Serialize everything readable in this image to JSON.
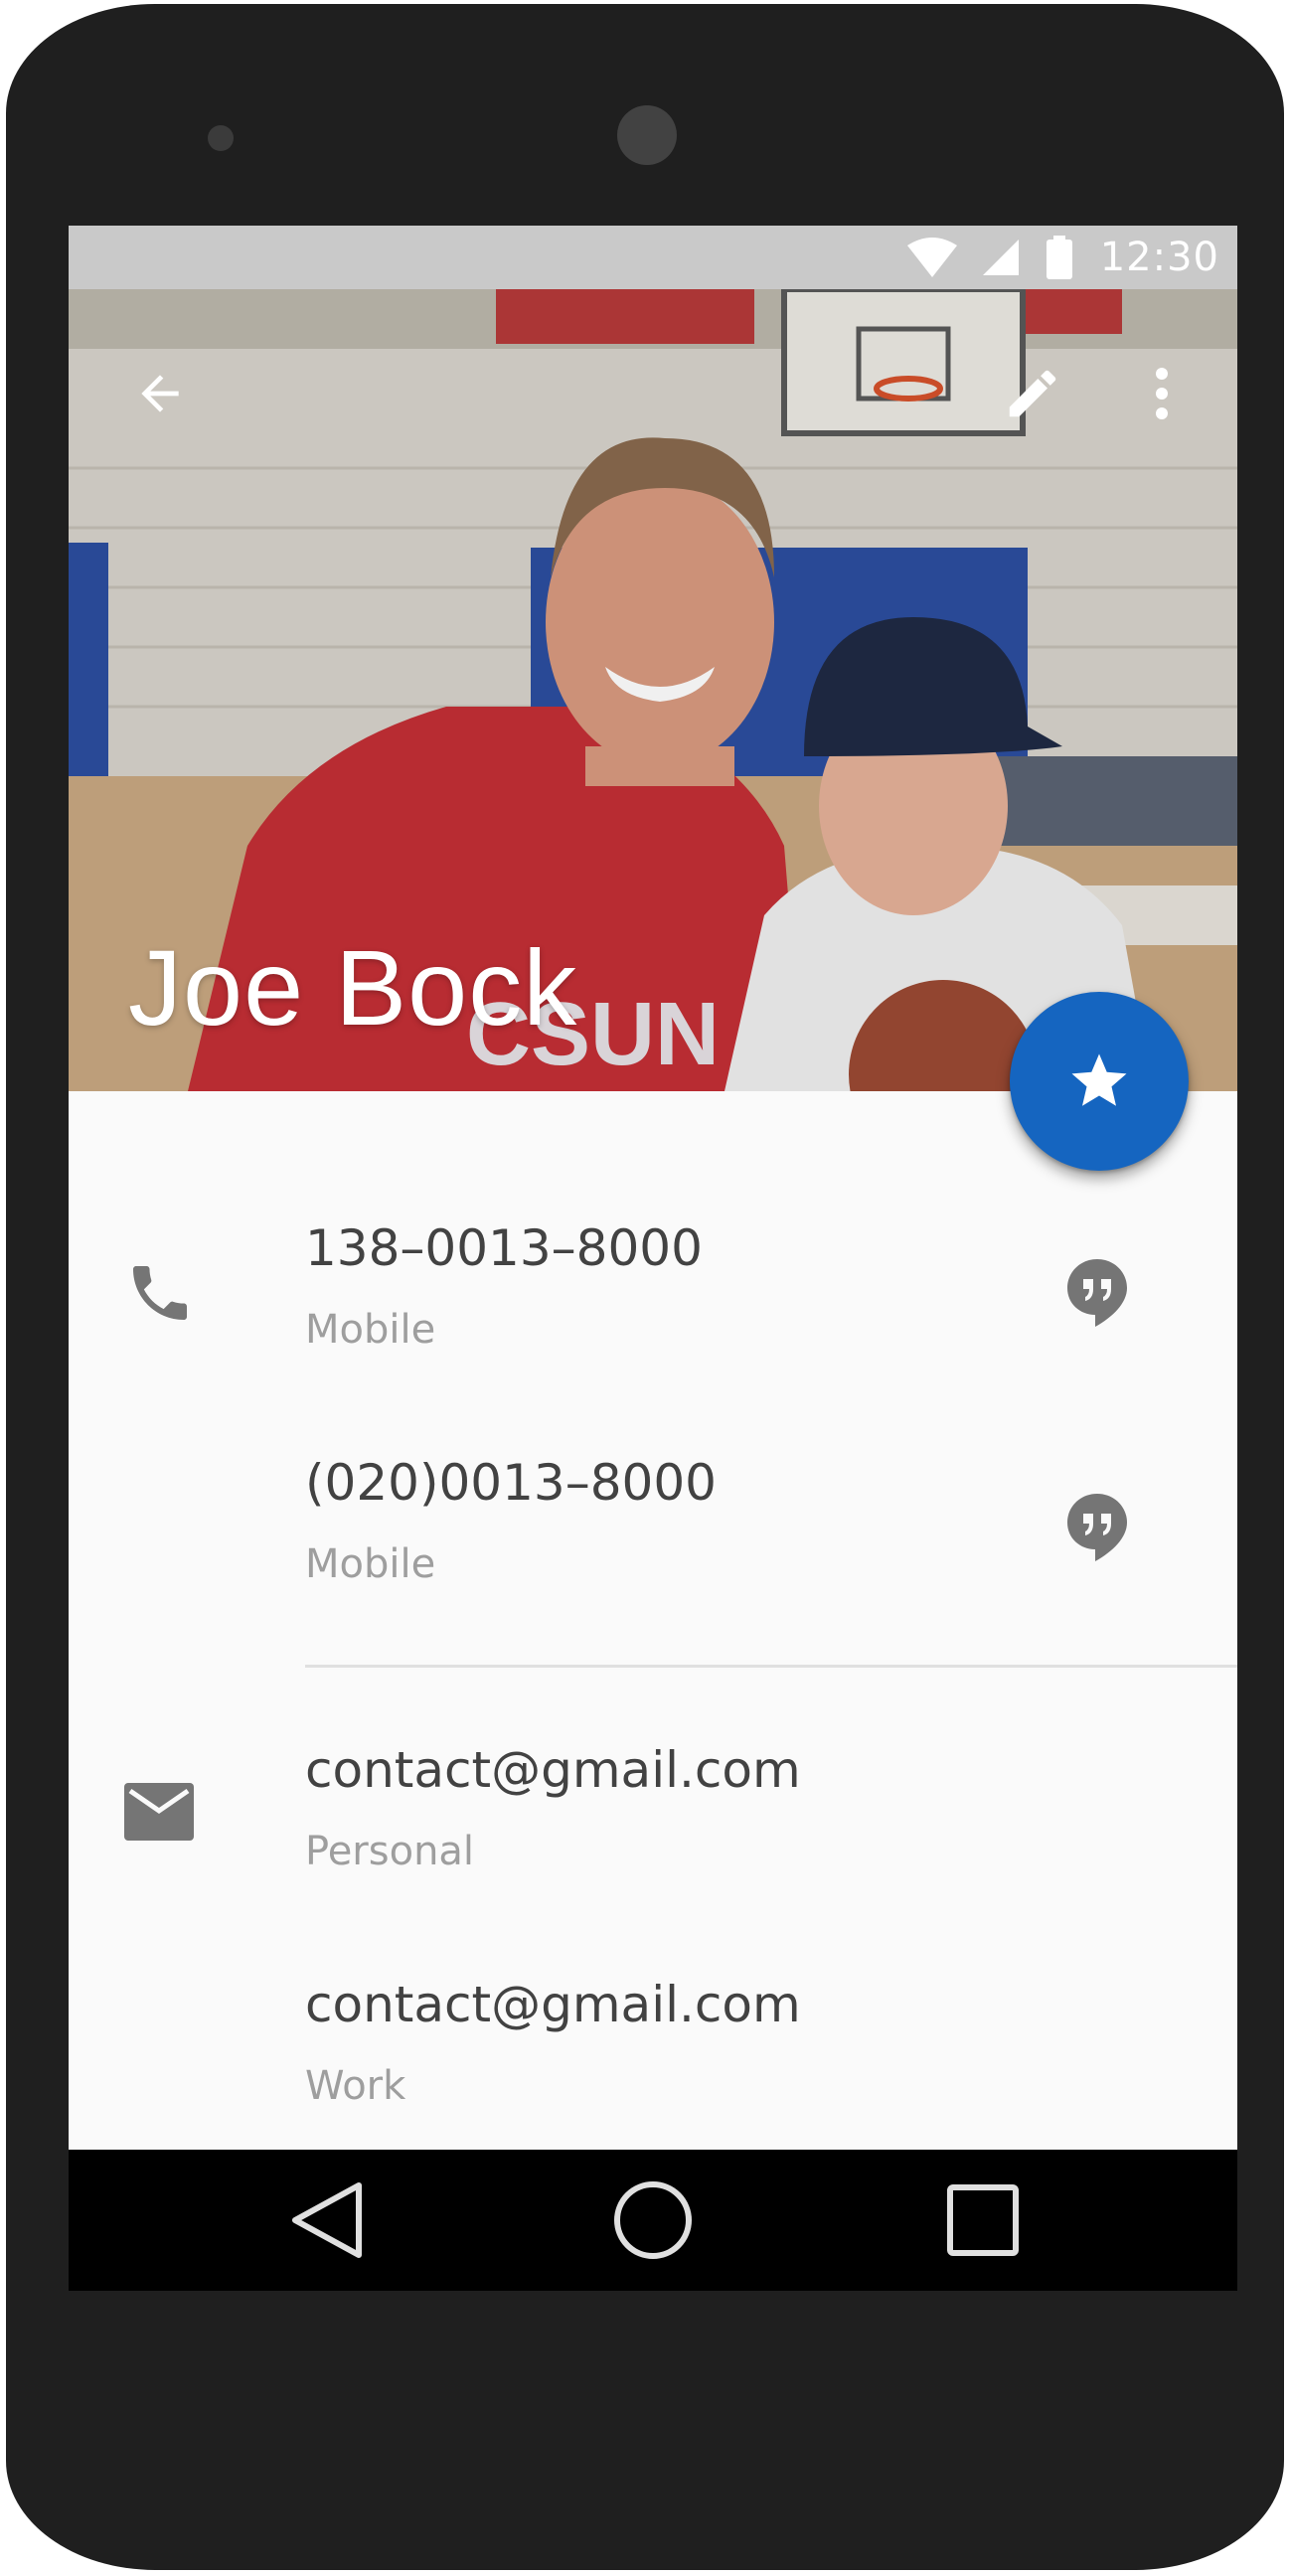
{
  "status_bar": {
    "time": "12:30"
  },
  "contact": {
    "name": "Joe Bock"
  },
  "phones": [
    {
      "number": "138–0013–8000",
      "type": "Mobile"
    },
    {
      "number": "(020)0013–8000",
      "type": "Mobile"
    }
  ],
  "emails": [
    {
      "address": "contact@gmail.com",
      "type": "Personal"
    },
    {
      "address": "contact@gmail.com",
      "type": "Work"
    }
  ],
  "icons": {
    "back": "arrow-back-icon",
    "edit": "edit-icon",
    "more": "more-vert-icon",
    "favorite": "star-icon",
    "phone": "phone-icon",
    "message": "hangouts-message-icon",
    "email": "email-icon",
    "nav_back": "nav-back-icon",
    "nav_home": "nav-home-icon",
    "nav_recents": "nav-recents-icon"
  },
  "colors": {
    "accent": "#1565c0",
    "status_bar": "#c9c9c9",
    "device": "#1f1f1f",
    "primary_text": "#424242",
    "secondary_text": "#9e9e9e"
  }
}
